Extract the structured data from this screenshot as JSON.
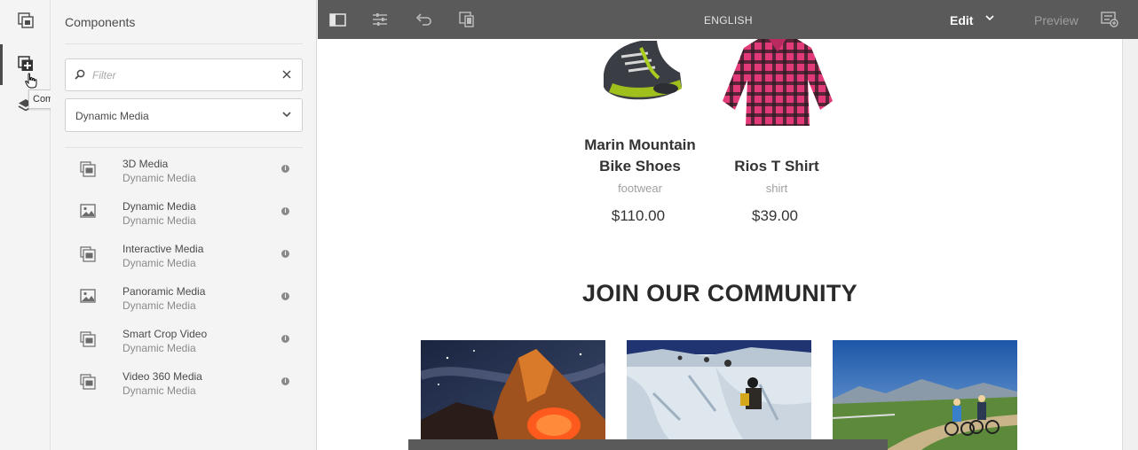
{
  "rail": {
    "tooltip": "Components",
    "buttons": [
      {
        "icon": "assets-icon"
      },
      {
        "icon": "components-icon"
      },
      {
        "icon": "layers-icon"
      }
    ]
  },
  "panel": {
    "title": "Components",
    "filter_placeholder": "Filter",
    "group_selected": "Dynamic Media",
    "items": [
      {
        "title": "3D Media",
        "group": "Dynamic Media",
        "icon": "media-set-icon"
      },
      {
        "title": "Dynamic Media",
        "group": "Dynamic Media",
        "icon": "image-icon"
      },
      {
        "title": "Interactive Media",
        "group": "Dynamic Media",
        "icon": "media-set-icon"
      },
      {
        "title": "Panoramic Media",
        "group": "Dynamic Media",
        "icon": "image-icon"
      },
      {
        "title": "Smart Crop Video",
        "group": "Dynamic Media",
        "icon": "media-set-icon"
      },
      {
        "title": "Video 360 Media",
        "group": "Dynamic Media",
        "icon": "media-set-icon"
      }
    ]
  },
  "toolbar": {
    "language": "ENGLISH",
    "mode": "Edit",
    "preview": "Preview"
  },
  "page": {
    "products": [
      {
        "name_line1": "Marin Mountain",
        "name_line2": "Bike Shoes",
        "category": "footwear",
        "price": "$110.00"
      },
      {
        "name_line1": "",
        "name_line2": "Rios T Shirt",
        "category": "shirt",
        "price": "$39.00"
      }
    ],
    "community_heading": "JOIN OUR COMMUNITY"
  },
  "colors": {
    "toolbar_bg": "#5a5a5a",
    "panel_bg": "#f4f4f4",
    "shirt_pink": "#e23a78"
  }
}
